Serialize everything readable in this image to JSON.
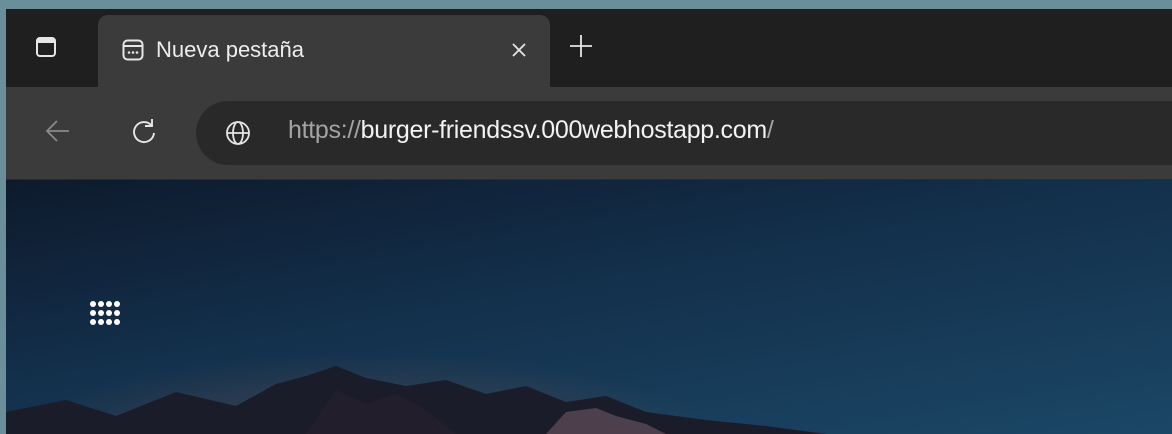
{
  "tab": {
    "title": "Nueva pestaña",
    "favicon": "new-tab-page-icon",
    "active": true
  },
  "tabstrip": {
    "tab_actions_icon": "tab-actions-icon",
    "close_icon": "close-icon",
    "new_tab_icon": "plus-icon"
  },
  "toolbar": {
    "back_icon": "arrow-left-icon",
    "back_enabled": false,
    "reload_icon": "refresh-icon"
  },
  "address_bar": {
    "site_icon": "globe-icon",
    "url_scheme": "https://",
    "url_host": "burger-friendssv.000webhostapp.com",
    "url_path": "/"
  },
  "content": {
    "apps_icon": "apps-grid-icon"
  },
  "colors": {
    "tabstrip_bg": "#1f1f1f",
    "active_tab_bg": "#3b3b3b",
    "omnibox_bg": "#292929",
    "url_host": "#f2f2f2",
    "url_muted": "#a3a3a3"
  }
}
